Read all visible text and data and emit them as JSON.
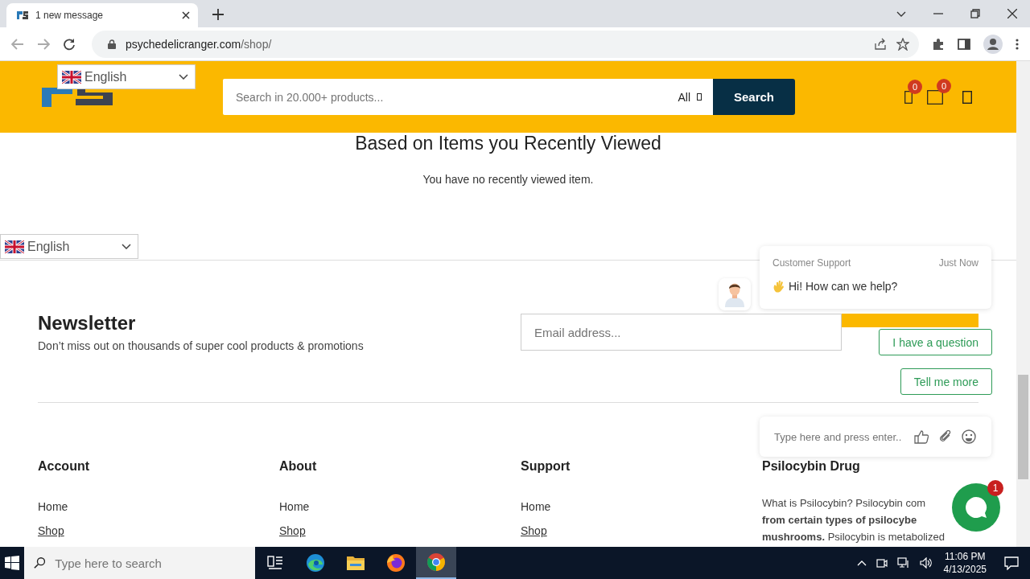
{
  "browser": {
    "tab_title": "1 new message",
    "url_host": "psychedelicranger.com",
    "url_path": "/shop/"
  },
  "header": {
    "language": "English",
    "search_placeholder": "Search in 20.000+ products...",
    "category": "All",
    "search_button": "Search",
    "badges": [
      "0",
      "0"
    ]
  },
  "recent": {
    "title": "Based on Items you Recently Viewed",
    "message": "You have no recently viewed item."
  },
  "language_selector": {
    "label": "English"
  },
  "newsletter": {
    "title": "Newsletter",
    "subtitle": "Don’t miss out on thousands of super cool products & promotions",
    "email_placeholder": "Email address..."
  },
  "footer": {
    "columns": [
      {
        "title": "Account",
        "links": [
          {
            "label": "Home",
            "underlined": false
          },
          {
            "label": "Shop",
            "underlined": true
          }
        ]
      },
      {
        "title": "About",
        "links": [
          {
            "label": "Home",
            "underlined": false
          },
          {
            "label": "Shop",
            "underlined": true
          }
        ]
      },
      {
        "title": "Support",
        "links": [
          {
            "label": "Home",
            "underlined": false
          },
          {
            "label": "Shop",
            "underlined": true
          }
        ]
      }
    ],
    "info": {
      "title": "Psilocybin Drug",
      "lines": [
        "What is Psilocybin? Psilocybin com",
        "**from certain types of psilocybe**",
        "**mushrooms.** Psilocybin is metabolized"
      ]
    }
  },
  "chat": {
    "agent": "Customer Support",
    "time": "Just Now",
    "message": "Hi! How can we help?",
    "quick_replies": [
      "I have a question",
      "Tell me more"
    ],
    "input_placeholder": "Type here and press enter..",
    "unread": "1"
  },
  "taskbar": {
    "search_placeholder": "Type here to search",
    "apps": [
      {
        "kind": "taskview",
        "selected": false
      },
      {
        "kind": "edge",
        "selected": false
      },
      {
        "kind": "folder",
        "selected": false
      },
      {
        "kind": "firefox",
        "selected": false
      },
      {
        "kind": "chrome",
        "selected": true
      }
    ],
    "time": "11:06 PM",
    "date": "4/13/2025"
  }
}
